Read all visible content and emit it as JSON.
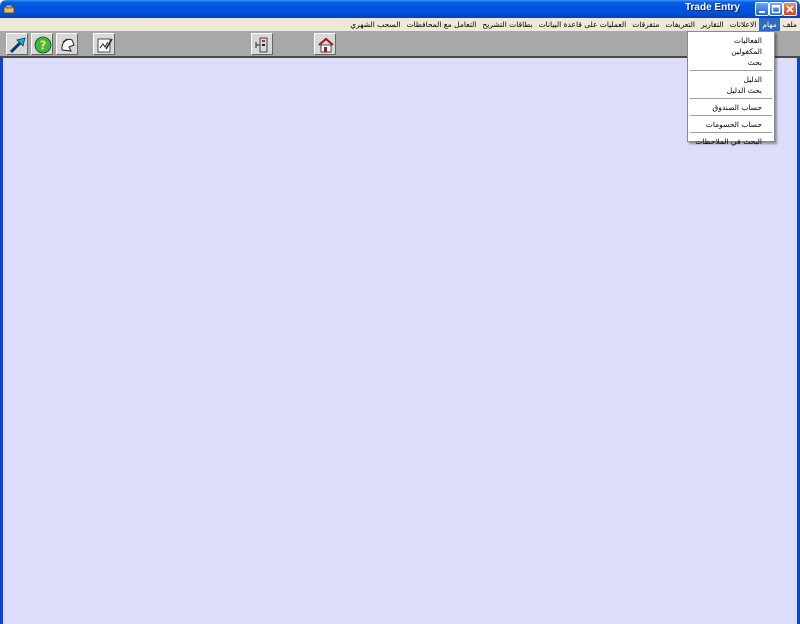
{
  "window": {
    "title": "Trade Entry"
  },
  "menubar": {
    "items": [
      "ملف",
      "مهام",
      "الاعلانات",
      "التقارير",
      "التعريفات",
      "متفرقات",
      "العمليات على قاعدة البيانات",
      "بطاقات التشريح",
      "التعامل مع المحافظات",
      "السحب الشهري"
    ],
    "active": "مهام"
  },
  "toolbar": {
    "buttons": [
      {
        "icon": "arrow-icon"
      },
      {
        "icon": "help-icon"
      },
      {
        "icon": "tool-icon"
      },
      {
        "icon": "edit-form-icon"
      },
      {
        "icon": "network-icon"
      },
      {
        "icon": "house-icon"
      }
    ]
  },
  "dropdown": {
    "groups": [
      [
        "الفعاليات",
        "المكفولين",
        "بحث"
      ],
      [
        "الدليل",
        "بحث الدليل"
      ],
      [
        "حساب الصندوق"
      ],
      [
        "حساب الحسومات"
      ],
      [
        "البحث في الملاحظات"
      ]
    ]
  },
  "colors": {
    "client_bg": "#dcdcfb",
    "title_blue": "#0054e3",
    "menu_highlight": "#316ac5",
    "toolbar_bg": "#a8a8a8"
  }
}
